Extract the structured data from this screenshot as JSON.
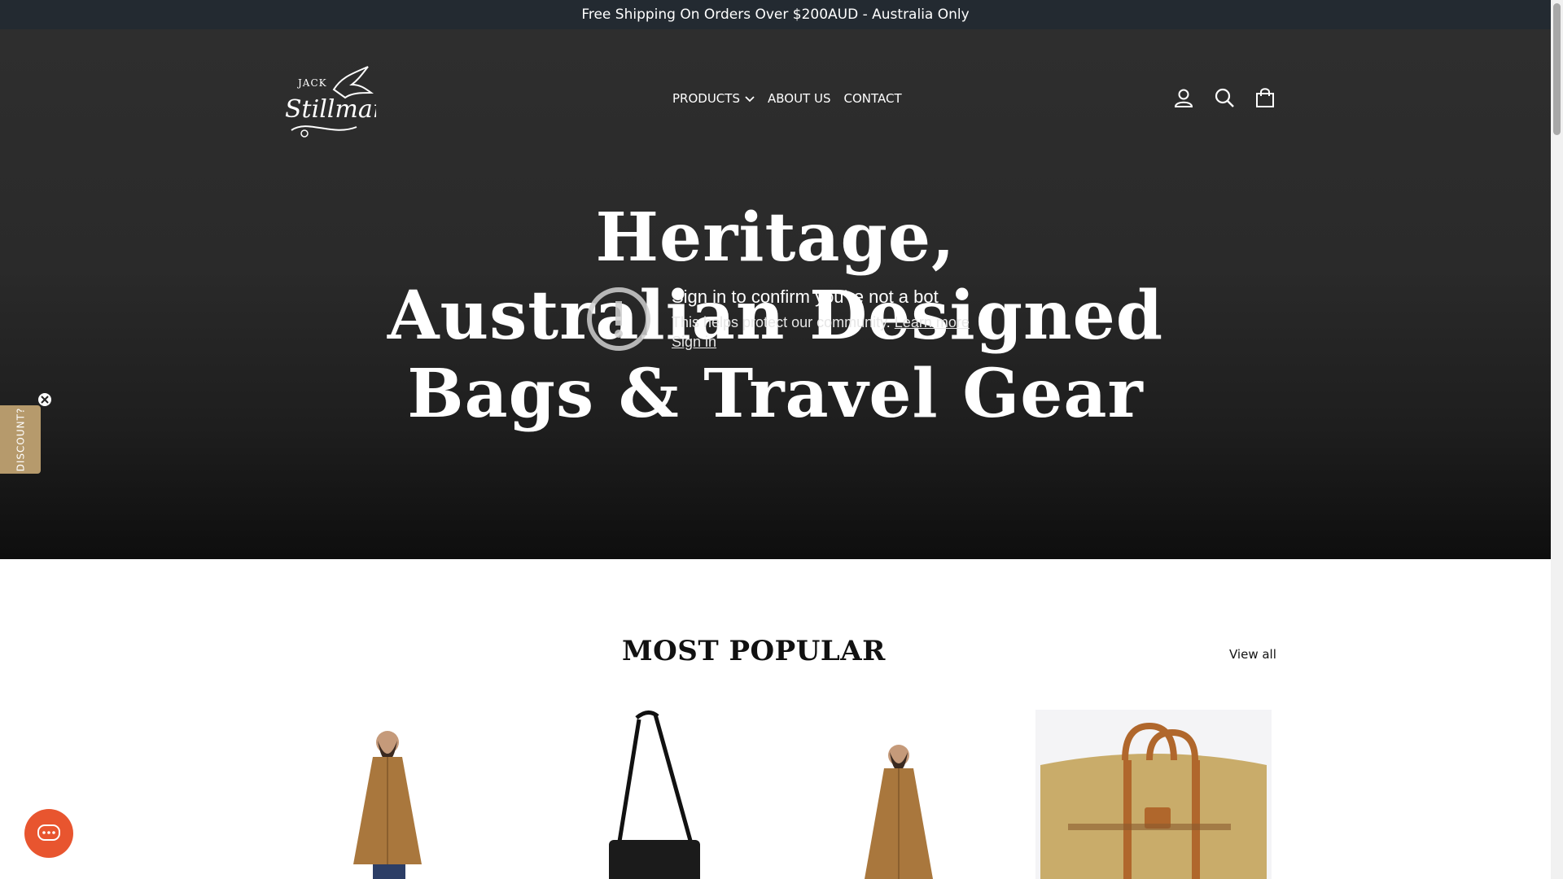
{
  "announcement": {
    "text": "Free Shipping On Orders Over $200AUD - Australia Only"
  },
  "header": {
    "logo": {
      "line1": "JACK",
      "line2": "Stillman"
    },
    "nav": [
      {
        "label": "PRODUCTS",
        "has_dropdown": true
      },
      {
        "label": "ABOUT US"
      },
      {
        "label": "CONTACT"
      }
    ],
    "icons": [
      "account-icon",
      "search-icon",
      "cart-bag-icon"
    ]
  },
  "hero": {
    "title_lines": [
      "Heritage,",
      "Australian Designed",
      "Bags & Travel Gear"
    ]
  },
  "bot_check": {
    "title": "Sign in to confirm you’re not a bot",
    "text": "This helps protect our community.",
    "learn_more": "Learn more",
    "sign_in": "Sign in"
  },
  "discount_tab": {
    "label": "DISCOUNT?"
  },
  "popular": {
    "heading": "MOST POPULAR",
    "view_all": "View all",
    "products": [
      {
        "name": "poncho-product-image"
      },
      {
        "name": "crossbody-bag-product-image"
      },
      {
        "name": "poncho-product-image-2"
      },
      {
        "name": "duffle-bag-product-image"
      }
    ]
  },
  "colors": {
    "announcement_bg": "#232a31",
    "hero_bg": "#2a2a2a",
    "discount_tab": "#b69a6c",
    "chat_button": "#e8552f",
    "product_tan": "#a9773d"
  }
}
